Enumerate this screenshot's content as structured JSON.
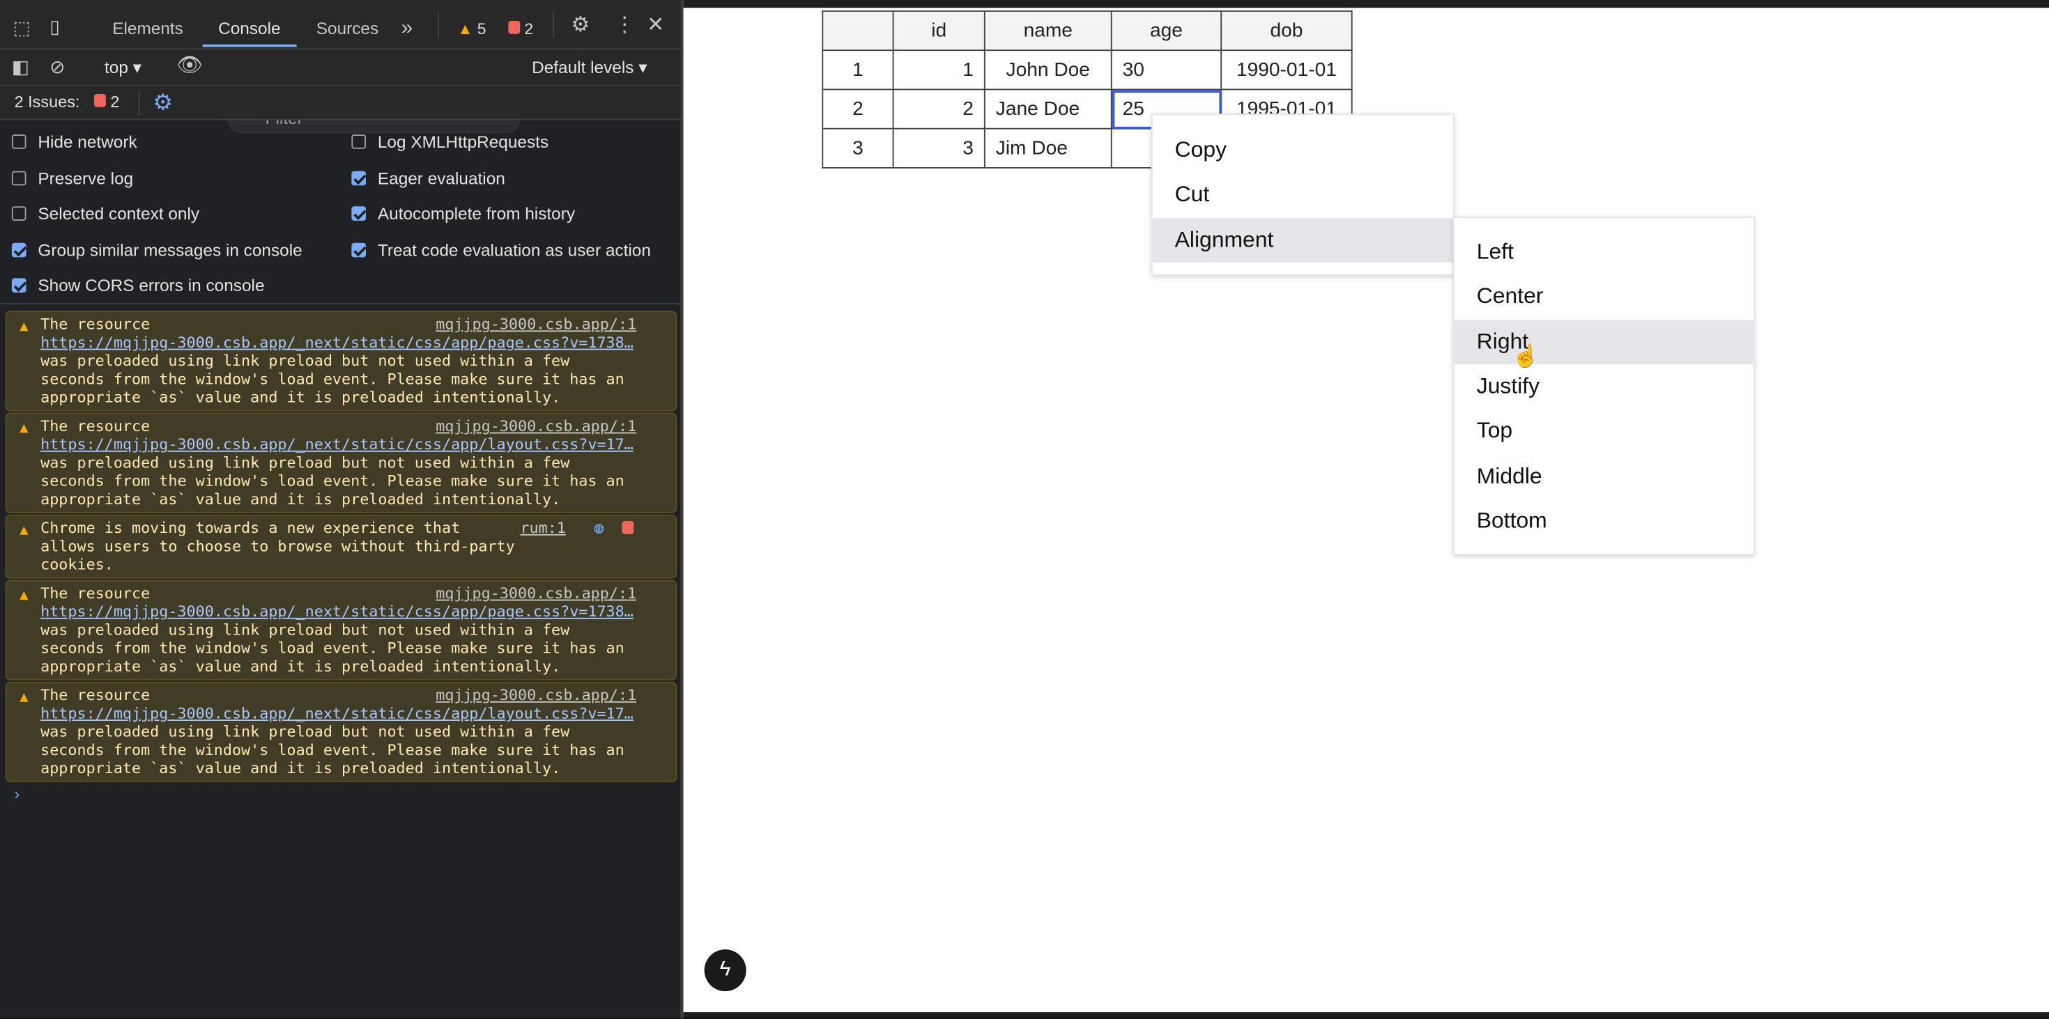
{
  "devtools": {
    "tabs": [
      "Elements",
      "Console",
      "Sources"
    ],
    "more_tabs": "»",
    "warnings_count": "5",
    "issues_count": "2",
    "toolbar": {
      "context": "top",
      "filter_placeholder": "Filter",
      "levels": "Default levels"
    },
    "issues_bar": {
      "label": "2 Issues:",
      "count": "2"
    },
    "settings": {
      "left": [
        {
          "label": "Hide network",
          "checked": false
        },
        {
          "label": "Preserve log",
          "checked": false
        },
        {
          "label": "Selected context only",
          "checked": false
        },
        {
          "label": "Group similar messages in console",
          "checked": true
        },
        {
          "label": "Show CORS errors in console",
          "checked": true
        }
      ],
      "right": [
        {
          "label": "Log XMLHttpRequests",
          "checked": false
        },
        {
          "label": "Eager evaluation",
          "checked": true
        },
        {
          "label": "Autocomplete from history",
          "checked": true
        },
        {
          "label": "Treat code evaluation as user action",
          "checked": true
        }
      ]
    },
    "messages": [
      {
        "source": "mqjjpg-3000.csb.app/:1",
        "lines": [
          "The resource",
          "https://mqjjpg-3000.csb.app/_next/static/css/app/page.css?v=1738…",
          "was preloaded using link preload but not used within a few",
          "seconds from the window's load event. Please make sure it has an",
          "appropriate `as` value and it is preloaded intentionally."
        ]
      },
      {
        "source": "mqjjpg-3000.csb.app/:1",
        "lines": [
          "The resource",
          "https://mqjjpg-3000.csb.app/_next/static/css/app/layout.css?v=17…",
          "was preloaded using link preload but not used within a few",
          "seconds from the window's load event. Please make sure it has an",
          "appropriate `as` value and it is preloaded intentionally."
        ]
      },
      {
        "source": "rum:1",
        "lines": [
          "Chrome is moving towards a new experience that",
          "allows users to choose to browse without third-party",
          "cookies."
        ]
      },
      {
        "source": "mqjjpg-3000.csb.app/:1",
        "lines": [
          "The resource",
          "https://mqjjpg-3000.csb.app/_next/static/css/app/page.css?v=1738…",
          "was preloaded using link preload but not used within a few",
          "seconds from the window's load event. Please make sure it has an",
          "appropriate `as` value and it is preloaded intentionally."
        ]
      },
      {
        "source": "mqjjpg-3000.csb.app/:1",
        "lines": [
          "The resource",
          "https://mqjjpg-3000.csb.app/_next/static/css/app/layout.css?v=17…",
          "was preloaded using link preload but not used within a few",
          "seconds from the window's load event. Please make sure it has an",
          "appropriate `as` value and it is preloaded intentionally."
        ]
      }
    ],
    "prompt": "›"
  },
  "table": {
    "headers": [
      "",
      "id",
      "name",
      "age",
      "dob"
    ],
    "rows": [
      [
        "1",
        "1",
        "John Doe",
        "30",
        "1990-01-01"
      ],
      [
        "2",
        "2",
        "Jane Doe",
        "25",
        "1995-01-01"
      ],
      [
        "3",
        "3",
        "Jim Doe",
        "",
        ""
      ]
    ]
  },
  "context_menu": {
    "items": [
      "Copy",
      "Cut",
      "Alignment"
    ],
    "highlighted": "Alignment"
  },
  "alignment_submenu": {
    "items": [
      "Left",
      "Center",
      "Right",
      "Justify",
      "Top",
      "Middle",
      "Bottom"
    ],
    "highlighted": "Right"
  },
  "fab_icon": "lightning-icon"
}
